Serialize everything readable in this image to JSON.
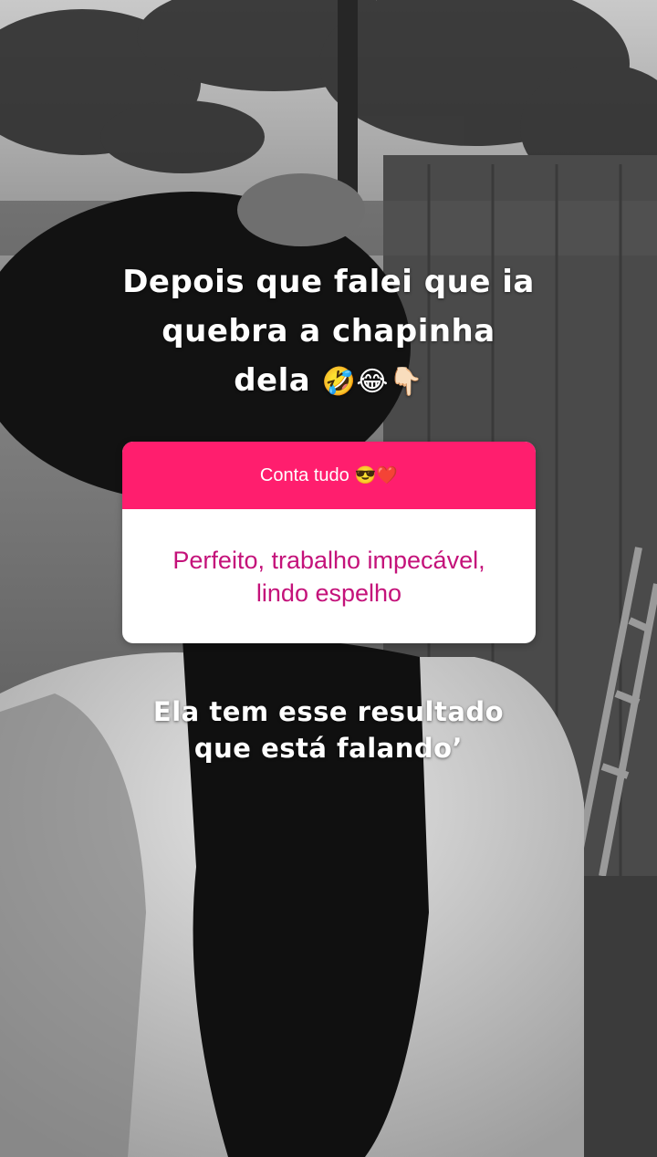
{
  "caption_top": {
    "line1": "Depois que falei que ia",
    "line2": "quebra a chapinha",
    "line3_text": "dela",
    "line3_emoji": "🤣😂👇🏻"
  },
  "question_sticker": {
    "prompt": "Conta tudo",
    "prompt_emoji": "😎❤️",
    "answer_line1": "Perfeito, trabalho impecável,",
    "answer_line2": "lindo espelho",
    "header_color": "#ff1e6e",
    "answer_color": "#c4127a"
  },
  "caption_bottom": {
    "line1": "Ela tem esse resultado",
    "line2": "que está falando’"
  }
}
